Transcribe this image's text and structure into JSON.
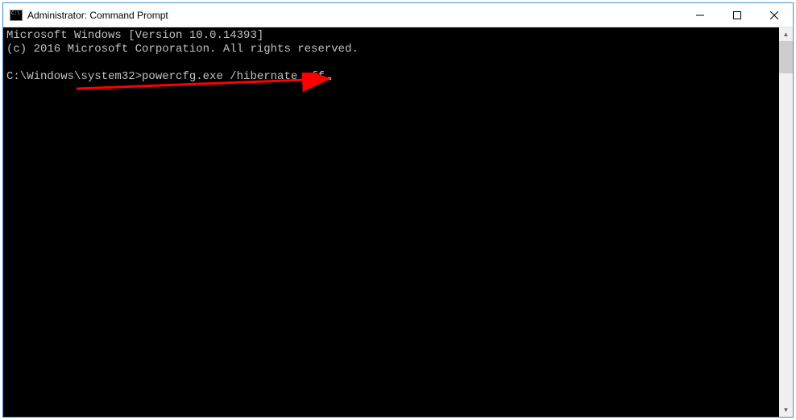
{
  "window": {
    "title": "Administrator: Command Prompt"
  },
  "terminal": {
    "line1": "Microsoft Windows [Version 10.0.14393]",
    "line2": "(c) 2016 Microsoft Corporation. All rights reserved.",
    "prompt": "C:\\Windows\\system32>",
    "command": "powercfg.exe /hibernate off"
  }
}
